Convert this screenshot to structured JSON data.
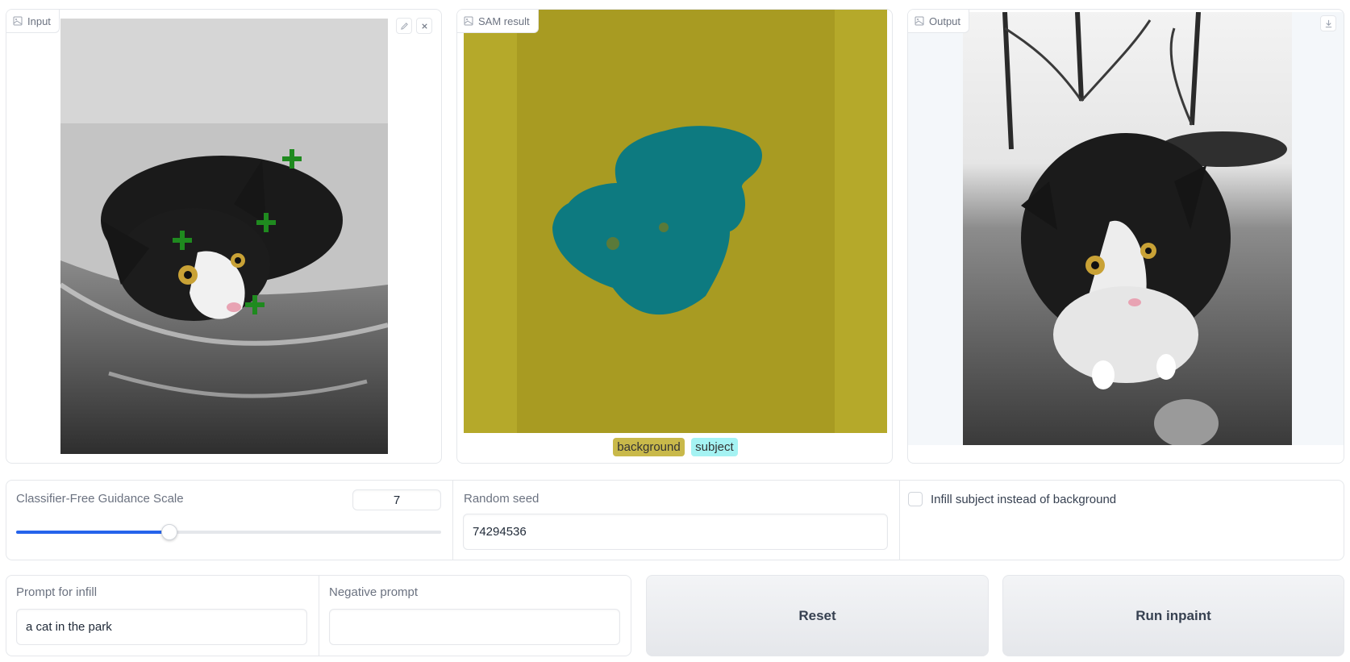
{
  "panels": {
    "input": {
      "label": "Input"
    },
    "sam": {
      "label": "SAM result",
      "legend": [
        {
          "label": "background",
          "color": "#c9b94a"
        },
        {
          "label": "subject",
          "color": "#a5f3f3"
        }
      ]
    },
    "output": {
      "label": "Output"
    }
  },
  "controls": {
    "cfg": {
      "label": "Classifier-Free Guidance Scale",
      "value": "7",
      "fraction": 0.36
    },
    "seed": {
      "label": "Random seed",
      "value": "74294536"
    },
    "infill_toggle": {
      "label": "Infill subject instead of background",
      "checked": false
    }
  },
  "prompts": {
    "infill": {
      "label": "Prompt for infill",
      "value": "a cat in the park"
    },
    "negative": {
      "label": "Negative prompt",
      "value": ""
    }
  },
  "buttons": {
    "reset": "Reset",
    "run": "Run inpaint"
  },
  "colors": {
    "mask_background": "#b5a92a",
    "mask_subject": "#0d7a80",
    "slider_fill": "#2563eb"
  }
}
